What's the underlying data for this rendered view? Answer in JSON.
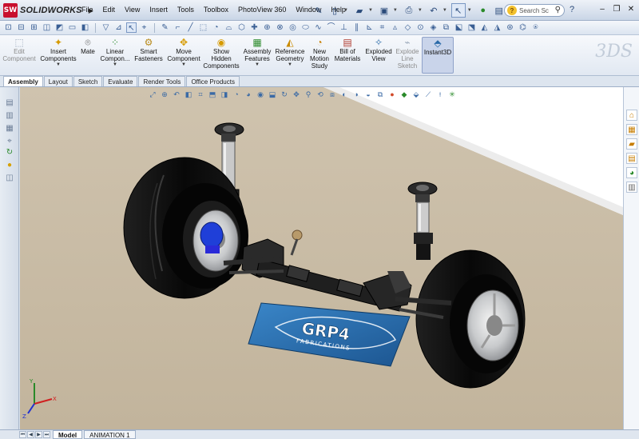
{
  "app": {
    "logo_abbrev": "SW",
    "logo_text": "SOLIDWORKS"
  },
  "menu": [
    "File",
    "Edit",
    "View",
    "Insert",
    "Tools",
    "Toolbox",
    "PhotoView 360",
    "Window",
    "Help"
  ],
  "search": {
    "placeholder": "Search Sc"
  },
  "command_manager": [
    {
      "label": "Edit\nComponent",
      "dim": true,
      "drop": false,
      "icon": "edit-component-icon"
    },
    {
      "label": "Insert\nComponents",
      "dim": false,
      "drop": true,
      "icon": "insert-components-icon"
    },
    {
      "label": "Mate",
      "dim": false,
      "drop": false,
      "icon": "mate-icon"
    },
    {
      "label": "Linear\nCompon...",
      "dim": false,
      "drop": true,
      "icon": "linear-pattern-icon"
    },
    {
      "label": "Smart\nFasteners",
      "dim": false,
      "drop": false,
      "icon": "smart-fasteners-icon"
    },
    {
      "label": "Move\nComponent",
      "dim": false,
      "drop": true,
      "icon": "move-component-icon"
    },
    {
      "label": "Show\nHidden\nComponents",
      "dim": false,
      "drop": false,
      "icon": "show-hidden-icon"
    },
    {
      "label": "Assembly\nFeatures",
      "dim": false,
      "drop": true,
      "icon": "assembly-features-icon"
    },
    {
      "label": "Reference\nGeometry",
      "dim": false,
      "drop": true,
      "icon": "reference-geometry-icon"
    },
    {
      "label": "New\nMotion\nStudy",
      "dim": false,
      "drop": false,
      "icon": "motion-study-icon"
    },
    {
      "label": "Bill of\nMaterials",
      "dim": false,
      "drop": false,
      "icon": "bill-of-materials-icon"
    },
    {
      "label": "Exploded\nView",
      "dim": false,
      "drop": false,
      "icon": "exploded-view-icon"
    },
    {
      "label": "Explode\nLine\nSketch",
      "dim": true,
      "drop": false,
      "icon": "explode-line-icon"
    },
    {
      "label": "Instant3D",
      "dim": false,
      "drop": false,
      "icon": "instant3d-icon",
      "active": true
    }
  ],
  "tabs": [
    "Assembly",
    "Layout",
    "Sketch",
    "Evaluate",
    "Render Tools",
    "Office Products"
  ],
  "active_tab": "Assembly",
  "bottom_tabs": [
    "Model",
    "ANIMATION 1"
  ],
  "active_bottom_tab": "Model",
  "banner": {
    "brand": "GRP4",
    "sub": "FABRICATIONS"
  },
  "colors": {
    "floor": "#c9bca7",
    "sky": "#ffffff",
    "tire": "#0c0c0c",
    "banner": "#2a6aa8",
    "accent_blue": "#1f3fd8"
  }
}
